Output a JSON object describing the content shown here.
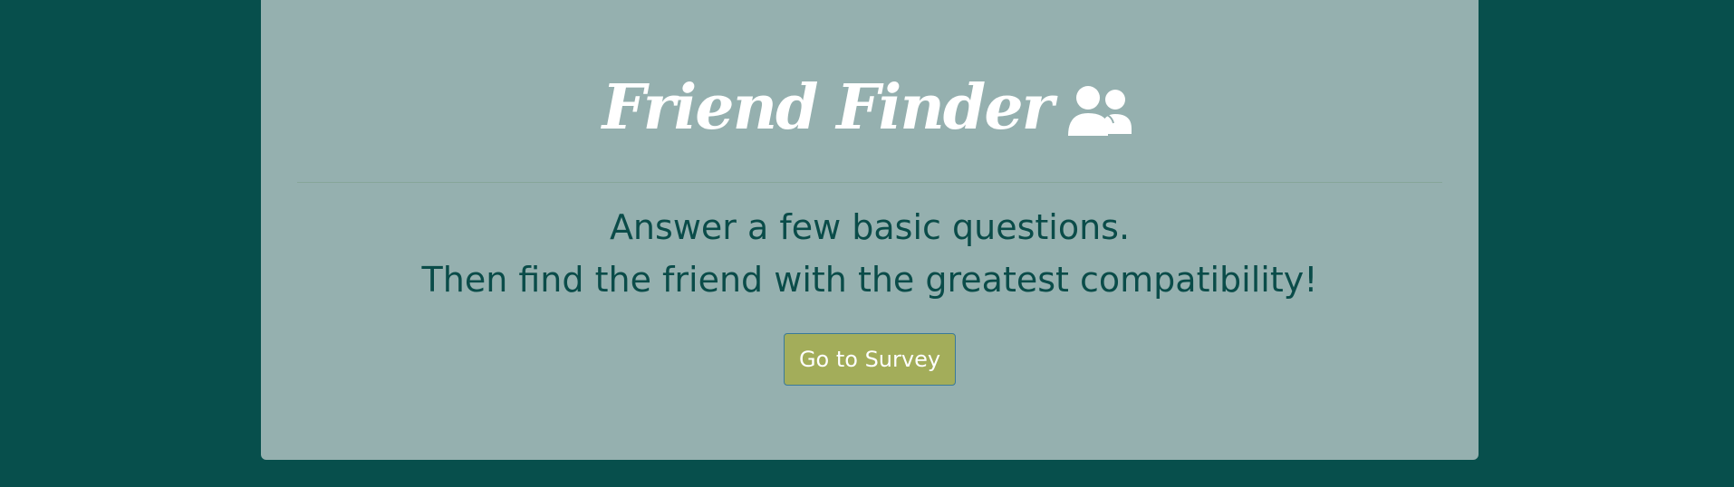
{
  "page": {
    "background_color": "#074f4c",
    "panel_color": "#95b0af"
  },
  "header": {
    "title": "Friend Finder",
    "icon": "users-icon"
  },
  "main": {
    "line1": "Answer a few basic questions.",
    "line2": "Then find the friend with the greatest compatibility!",
    "survey_button_label": "Go to Survey",
    "button_color": "#a3ad5a"
  }
}
